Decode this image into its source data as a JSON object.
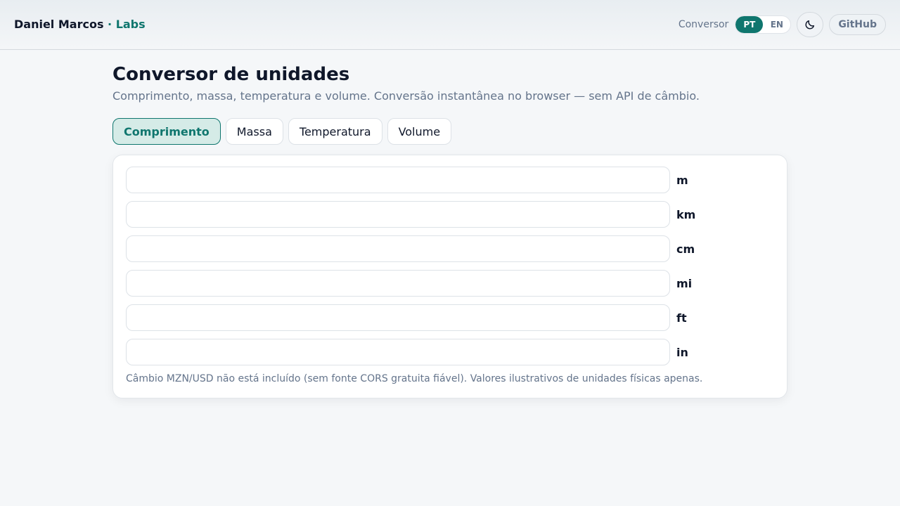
{
  "header": {
    "brand_name": "Daniel Marcos",
    "brand_sep": " · ",
    "brand_suffix": "Labs",
    "nav_label": "Conversor",
    "lang_options": [
      "PT",
      "EN"
    ],
    "lang_selected": "PT",
    "theme_icon": "moon-icon",
    "github_label": "GitHub"
  },
  "main": {
    "title": "Conversor de unidades",
    "subtitle": "Comprimento, massa, temperatura e volume. Conversão instantânea no browser — sem API de câmbio.",
    "tabs": [
      {
        "label": "Comprimento",
        "active": true
      },
      {
        "label": "Massa",
        "active": false
      },
      {
        "label": "Temperatura",
        "active": false
      },
      {
        "label": "Volume",
        "active": false
      }
    ],
    "fields": [
      {
        "unit": "m",
        "value": ""
      },
      {
        "unit": "km",
        "value": ""
      },
      {
        "unit": "cm",
        "value": ""
      },
      {
        "unit": "mi",
        "value": ""
      },
      {
        "unit": "ft",
        "value": ""
      },
      {
        "unit": "in",
        "value": ""
      }
    ],
    "note": "Câmbio MZN/USD não está incluído (sem fonte CORS gratuita fiável). Valores ilustrativos de unidades físicas apenas."
  },
  "colors": {
    "accent": "#0f766e",
    "accent_bg": "#d5ebe7",
    "background": "#f5f7f9",
    "text": "#0f172a",
    "muted": "#64748b"
  }
}
